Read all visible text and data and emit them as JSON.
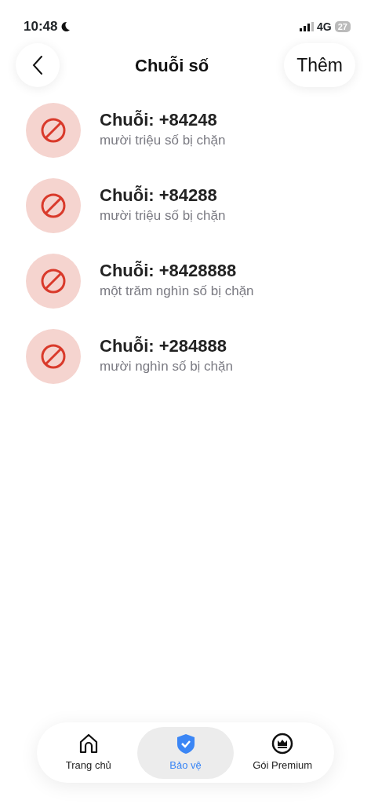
{
  "status_bar": {
    "time": "10:48",
    "network": "4G",
    "battery": "27"
  },
  "header": {
    "title": "Chuỗi số",
    "action": "Thêm"
  },
  "items": [
    {
      "title": "Chuỗi: +84248",
      "subtitle": "mười triệu số bị chặn"
    },
    {
      "title": "Chuỗi: +84288",
      "subtitle": "mười triệu số bị chặn"
    },
    {
      "title": "Chuỗi: +8428888",
      "subtitle": "một trăm nghìn số bị chặn"
    },
    {
      "title": "Chuỗi: +284888",
      "subtitle": "mười nghìn số bị chặn"
    }
  ],
  "tabs": [
    {
      "label": "Trang chủ",
      "kind": "home",
      "selected": false
    },
    {
      "label": "Bảo vệ",
      "kind": "shield",
      "selected": true
    },
    {
      "label": "Gói Premium",
      "kind": "crown",
      "selected": false
    }
  ]
}
